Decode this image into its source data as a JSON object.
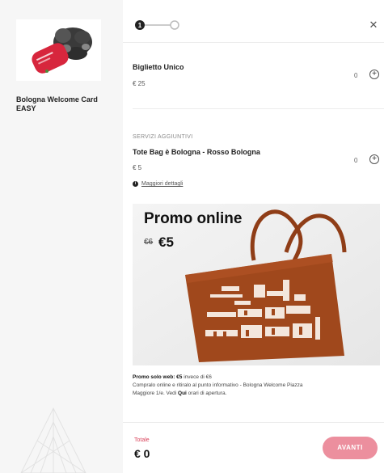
{
  "product": {
    "name": "Bologna Welcome Card EASY"
  },
  "stepper": {
    "current_step": "1",
    "total_steps": 2
  },
  "close_icon": "close-icon",
  "items": [
    {
      "title": "Biglietto Unico",
      "price": "€ 25",
      "quantity": "0"
    }
  ],
  "additional_services": {
    "label": "SERVIZI AGGIUNTIVI",
    "items": [
      {
        "title": "Tote Bag è Bologna - Rosso Bologna",
        "price": "€ 5",
        "quantity": "0"
      }
    ],
    "info_link": "Maggiori dettagli"
  },
  "promo": {
    "title": "Promo online",
    "old_price": "€6",
    "new_price": "€5",
    "bag_color": "#a0481c",
    "note_bold": "Promo solo web: €5",
    "note_rest": "invece di €6",
    "note_line2": "Compralo online e ritiralo al punto informativo - Bologna Welcome Piazza",
    "note_line3_pre": "Maggiore 1/e. Vedi",
    "note_line3_bold": "Qui",
    "note_line3_post": "orari di apertura."
  },
  "footer": {
    "total_label": "Totale",
    "total_value": "€ 0",
    "next_label": "AVANTI"
  },
  "colors": {
    "accent": "#d9435b",
    "button": "#ec8f9e"
  }
}
